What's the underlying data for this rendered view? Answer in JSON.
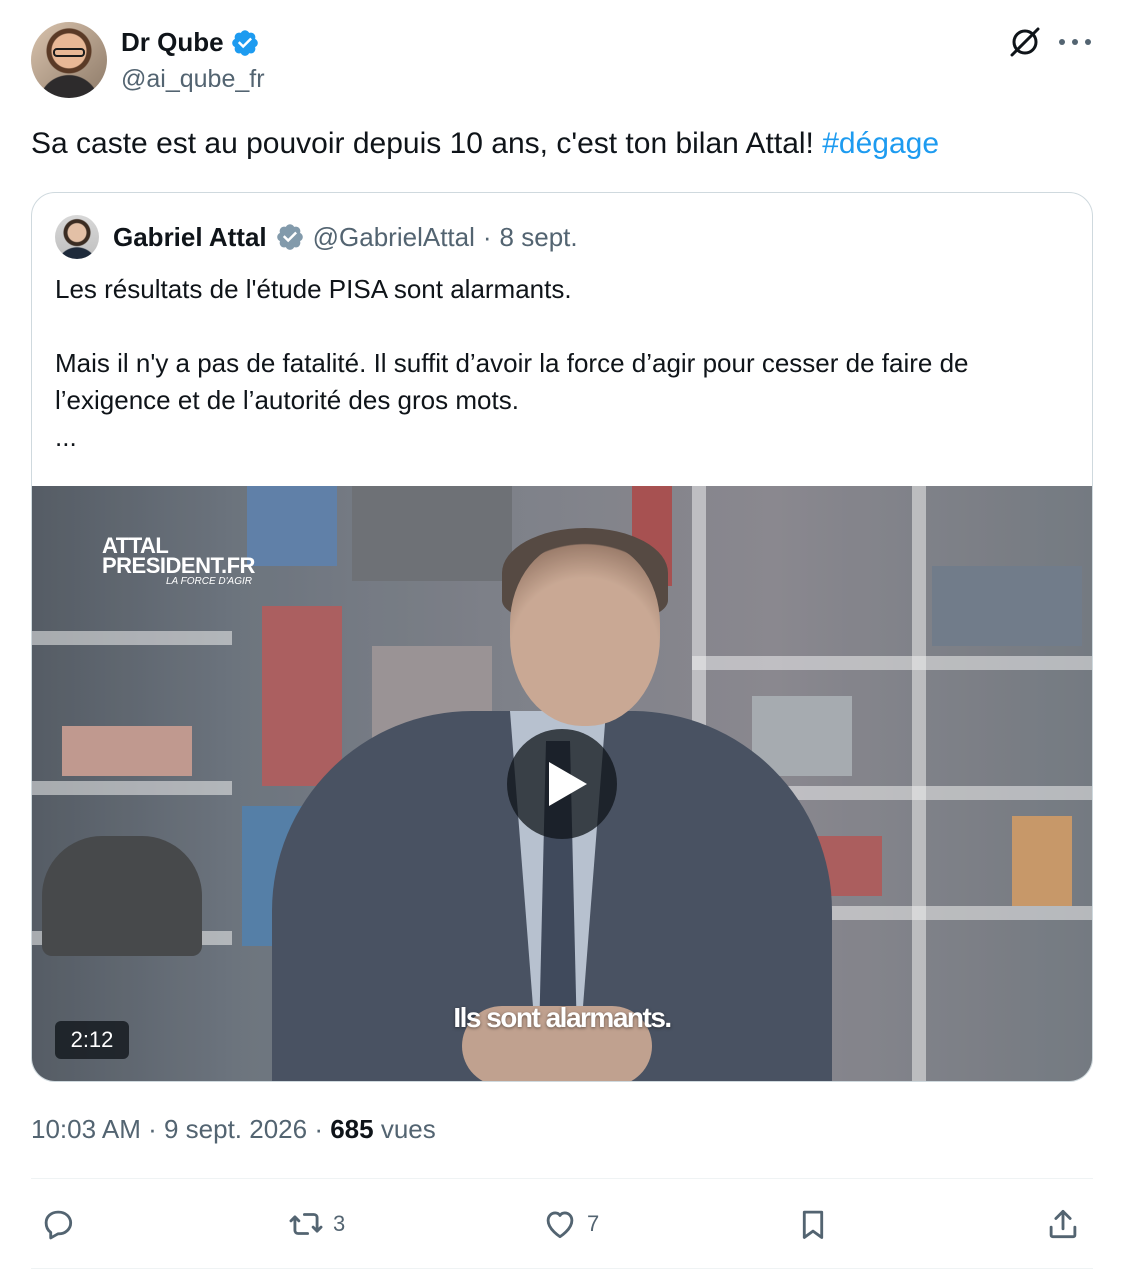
{
  "author": {
    "name": "Dr Qube",
    "handle": "@ai_qube_fr"
  },
  "tweet": {
    "text": "Sa caste est au pouvoir depuis 10 ans, c'est ton bilan Attal! ",
    "hashtag": "#dégage"
  },
  "quoted": {
    "name": "Gabriel Attal",
    "handle": "@GabrielAttal",
    "separator": " · ",
    "date": "8 sept.",
    "paragraph1": "Les résultats de l'étude PISA sont alarmants.",
    "paragraph2": "Mais il n'y a pas de fatalité. Il suffit d’avoir la force d’agir pour cesser de faire de l’exigence et de l’autorité des gros mots.",
    "ellipsis": "...",
    "video": {
      "logo_line1": "ATTAL",
      "logo_line2": "PRESIDENT.FR",
      "logo_line3": "LA FORCE D'AGIR",
      "subtitle": "Ils sont alarmants.",
      "duration": "2:12"
    }
  },
  "meta": {
    "time": "10:03 AM",
    "sep": " · ",
    "date": "9 sept. 2026",
    "views_count": "685",
    "views_label": " vues"
  },
  "actions": {
    "reply_count": "",
    "retweet_count": "3",
    "like_count": "7"
  },
  "colors": {
    "accent": "#1d9bf0",
    "text": "#0f1419",
    "muted": "#536471",
    "border": "#cfd9de"
  }
}
